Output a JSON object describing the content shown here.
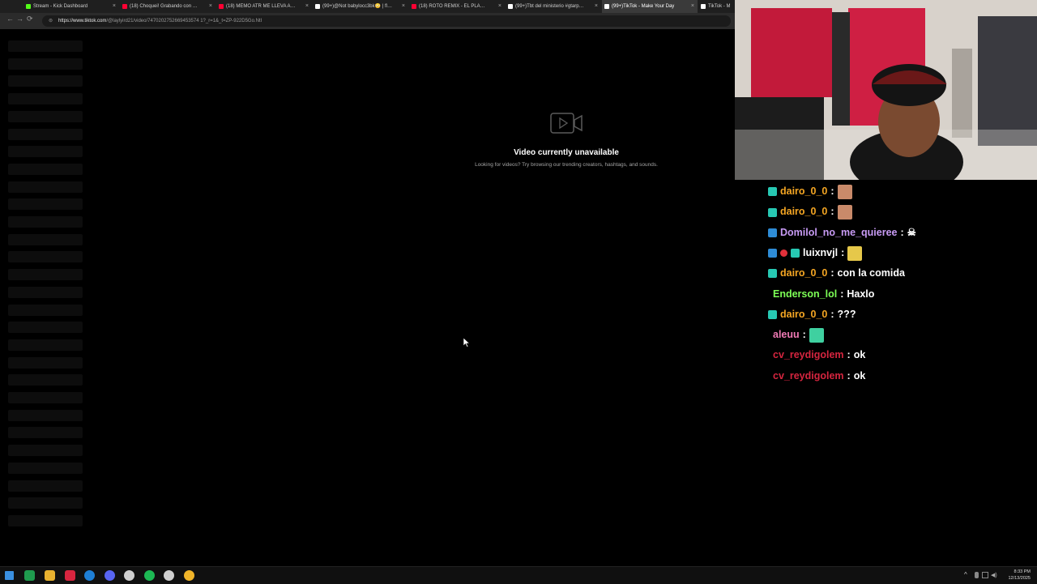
{
  "browser": {
    "tabs": [
      {
        "label": "Stream - Kick Dashboard",
        "favicon_color": "#53fc18",
        "active": false
      },
      {
        "label": "(18) Choquei! Grabando con @Me",
        "favicon_color": "#ff0033",
        "active": false
      },
      {
        "label": "(18) MEMO ATR ME LLEVA AL BR",
        "favicon_color": "#ff0033",
        "active": false
      },
      {
        "label": "(99+)@Not babylocc3bk😳 | flac",
        "favicon_color": "#ffffff",
        "active": false
      },
      {
        "label": "(18) ROTO REMIX - EL PLANTON",
        "favicon_color": "#ff0033",
        "active": false
      },
      {
        "label": "(99+)Tbt del ministerio #gtarp #g",
        "favicon_color": "#ffffff",
        "active": false
      },
      {
        "label": "(99+)TikTok - Make Your Day",
        "favicon_color": "#ffffff",
        "active": true
      },
      {
        "label": "TikTok - M",
        "favicon_color": "#ffffff",
        "active": false
      }
    ],
    "tab_close_glyph": "×",
    "url_host": "https://www.tiktok.com",
    "url_path": "/@laylyird21/video/7470202752669453574 1?_r=1&_t=ZP-922D5Go.NtI",
    "back_icon": "arrow-left-icon",
    "forward_icon": "arrow-right-icon",
    "reload_icon": "reload-icon"
  },
  "page": {
    "unavailable_title": "Video currently unavailable",
    "unavailable_subtitle": "Looking for videos? Try browsing our trending creators, hashtags, and sounds.",
    "skeleton_rows": 28
  },
  "chat": {
    "messages": [
      {
        "user": "dairo_0_0",
        "color": "#f5a623",
        "badges": [
          "sub"
        ],
        "text": "",
        "emote": "face-emote"
      },
      {
        "user": "dairo_0_0",
        "color": "#f5a623",
        "badges": [
          "sub"
        ],
        "text": "",
        "emote": "face-emote"
      },
      {
        "user": "Domilol_no_me_quieree",
        "color": "#c89bf5",
        "badges": [
          "mod"
        ],
        "text": "☠",
        "emote": ""
      },
      {
        "user": "luixnvjl",
        "color": "#ffffff",
        "badges": [
          "mod",
          "dot",
          "sub"
        ],
        "text": "",
        "emote": "car-emote"
      },
      {
        "user": "dairo_0_0",
        "color": "#f5a623",
        "badges": [
          "sub"
        ],
        "text": "con la comida",
        "emote": ""
      },
      {
        "user": "Enderson_lol",
        "color": "#7dff56",
        "badges": [],
        "text": "Haxlo",
        "emote": ""
      },
      {
        "user": "dairo_0_0",
        "color": "#f5a623",
        "badges": [
          "sub"
        ],
        "text": "???",
        "emote": ""
      },
      {
        "user": "aleuu",
        "color": "#f07ab5",
        "badges": [],
        "text": "",
        "emote": "bars-emote"
      },
      {
        "user": "cv_reydigolem",
        "color": "#d6253f",
        "badges": [],
        "text": "ok",
        "emote": ""
      },
      {
        "user": "cv_reydigolem",
        "color": "#d6253f",
        "badges": [],
        "text": "ok",
        "emote": ""
      }
    ],
    "separator": ":"
  },
  "taskbar": {
    "clock_time": "8:33 PM",
    "clock_date": "12/13/2025",
    "icons": [
      "windows-start-icon",
      "spreadsheet-icon",
      "file-explorer-icon",
      "app-red-icon",
      "edge-browser-icon",
      "discord-icon",
      "pen-tool-icon",
      "spotify-icon",
      "obs-icon",
      "chrome-icon"
    ],
    "tray_arrow": "^"
  }
}
